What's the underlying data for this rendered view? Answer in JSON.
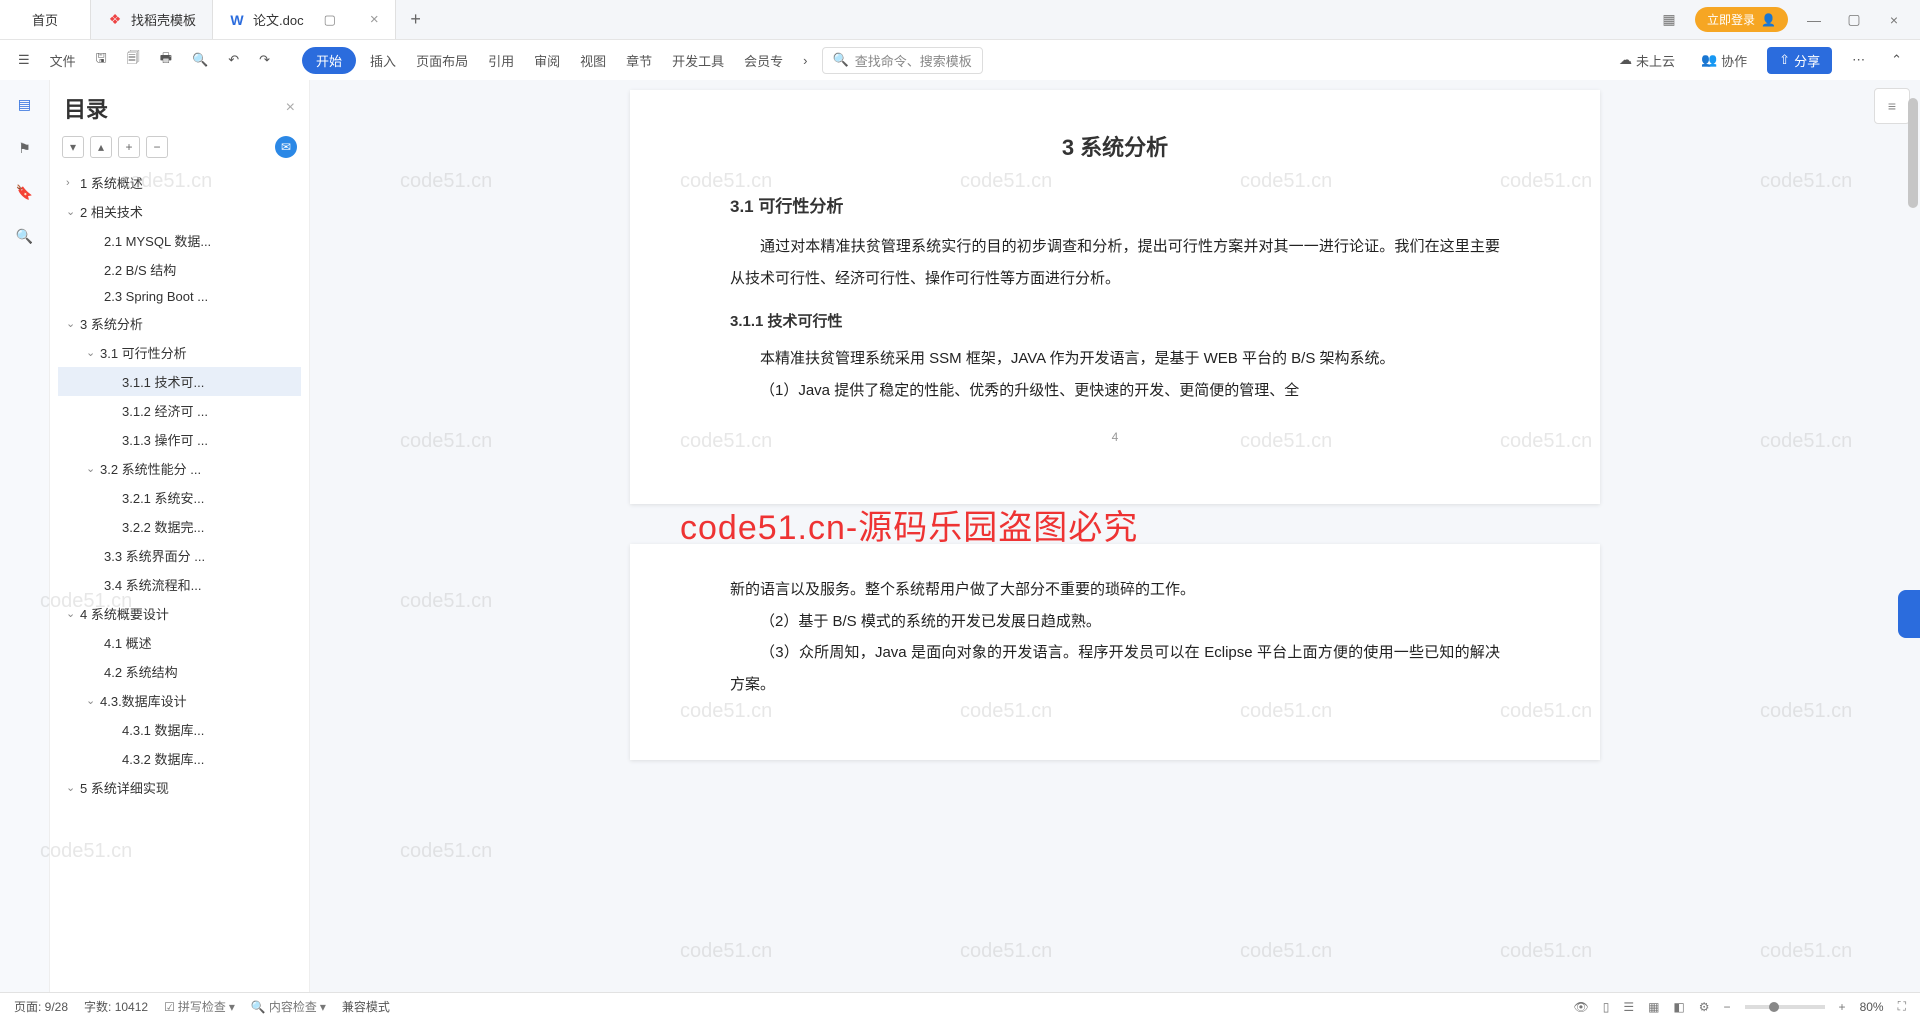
{
  "tabs": {
    "home": "首页",
    "t1": "找稻壳模板",
    "t2": "论文.doc"
  },
  "login": "立即登录",
  "ribbon": {
    "file": "文件",
    "menu": [
      "开始",
      "插入",
      "页面布局",
      "引用",
      "审阅",
      "视图",
      "章节",
      "开发工具",
      "会员专"
    ],
    "search": "查找命令、搜索模板",
    "cloud": "未上云",
    "collab": "协作",
    "share": "分享"
  },
  "outline": {
    "title": "目录"
  },
  "toc": {
    "i1": "1 系统概述",
    "i2": "2 相关技术",
    "i21": "2.1 MYSQL 数据...",
    "i22": "2.2 B/S 结构",
    "i23": "2.3 Spring Boot ...",
    "i3": "3 系统分析",
    "i31": "3.1 可行性分析",
    "i311": "3.1.1 技术可...",
    "i312": "3.1.2 经济可 ...",
    "i313": "3.1.3 操作可 ...",
    "i32": "3.2 系统性能分 ...",
    "i321": "3.2.1 系统安...",
    "i322": "3.2.2 数据完...",
    "i33": "3.3 系统界面分 ...",
    "i34": "3.4 系统流程和...",
    "i4": "4 系统概要设计",
    "i41": "4.1 概述",
    "i42": "4.2 系统结构",
    "i43": "4.3.数据库设计",
    "i431": "4.3.1 数据库...",
    "i432": "4.3.2 数据库...",
    "i5": "5 系统详细实现"
  },
  "doc": {
    "h3": "3 系统分析",
    "h31": "3.1 可行性分析",
    "p1": "通过对本精准扶贫管理系统实行的目的初步调查和分析，提出可行性方案并对其一一进行论证。我们在这里主要从技术可行性、经济可行性、操作可行性等方面进行分析。",
    "h311": "3.1.1 技术可行性",
    "p2": "本精准扶贫管理系统采用 SSM 框架，JAVA 作为开发语言，是基于 WEB 平台的 B/S 架构系统。",
    "p3": "（1）Java 提供了稳定的性能、优秀的升级性、更快速的开发、更简便的管理、全",
    "p2_1": "新的语言以及服务。整个系统帮用户做了大部分不重要的琐碎的工作。",
    "p2_2": "（2）基于 B/S 模式的系统的开发已发展日趋成熟。",
    "p2_3": "（3）众所周知，Java 是面向对象的开发语言。程序开发员可以在 Eclipse 平台上面方便的使用一些已知的解决方案。",
    "pgnum": "4"
  },
  "watermark_red": "code51.cn-源码乐园盗图必究",
  "status": {
    "page": "页面: 9/28",
    "words": "字数: 10412",
    "spell": "拼写检查",
    "content": "内容检查",
    "compat": "兼容模式",
    "zoom": "80%"
  }
}
